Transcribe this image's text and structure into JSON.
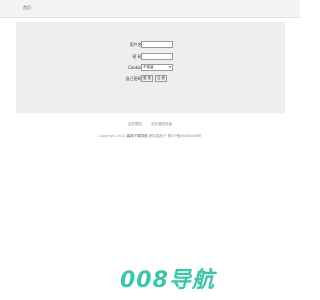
{
  "topbar": {
    "home_link": "首页"
  },
  "login": {
    "username_label": "用户名:",
    "username_value": "",
    "password_label": "密  码:",
    "password_value": "",
    "cookie_label": "Cookie:",
    "cookie_selected": "不保留",
    "action_label": "自己密码:",
    "login_button": "登 录",
    "cancel_button": "注 册"
  },
  "footer": {
    "links": [
      "会员登陆",
      "站长登陆页面"
    ],
    "copyright_prefix": "Copyright 2024",
    "brand": "森商下载导航",
    "copyright_suffix": "網站建設于 蜀ICP备88888888号"
  },
  "logo": {
    "text": "008导航",
    "color": "#3cc6a8"
  }
}
